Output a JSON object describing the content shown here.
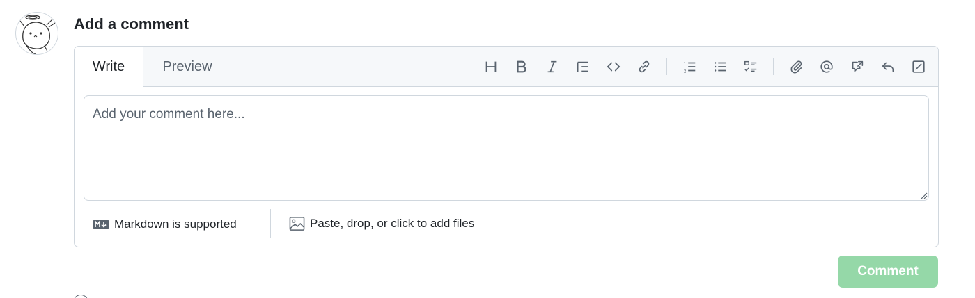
{
  "comment_form": {
    "heading": "Add a comment",
    "tabs": [
      {
        "label": "Write",
        "selected": true
      },
      {
        "label": "Preview",
        "selected": false
      }
    ],
    "toolbar": [
      {
        "name": "heading-icon"
      },
      {
        "name": "bold-icon"
      },
      {
        "name": "italic-icon"
      },
      {
        "name": "quote-icon"
      },
      {
        "name": "code-icon"
      },
      {
        "name": "link-icon"
      },
      {
        "name": "ordered-list-icon"
      },
      {
        "name": "unordered-list-icon"
      },
      {
        "name": "task-list-icon"
      },
      {
        "name": "attach-icon"
      },
      {
        "name": "mention-icon"
      },
      {
        "name": "cross-reference-icon"
      },
      {
        "name": "reply-icon"
      },
      {
        "name": "fullscreen-icon"
      }
    ],
    "textarea": {
      "placeholder": "Add your comment here...",
      "value": ""
    },
    "footer": {
      "markdown_note": "Markdown is supported",
      "files_note": "Paste, drop, or click to add files"
    },
    "submit_label": "Comment",
    "submit_enabled": false
  },
  "colors": {
    "border": "#d0d7de",
    "header_bg": "#f6f8fa",
    "muted_text": "#59636e",
    "submit_disabled_bg": "#95d8a8"
  }
}
